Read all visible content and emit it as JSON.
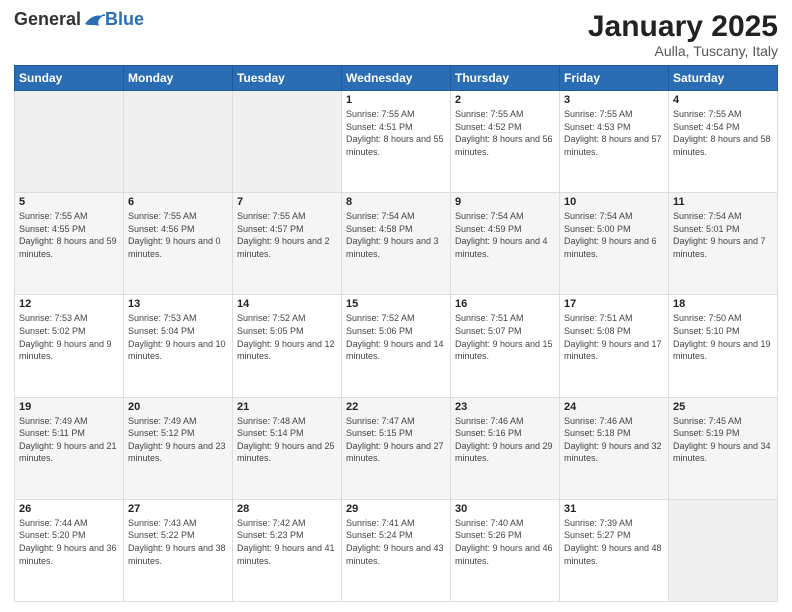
{
  "header": {
    "logo_general": "General",
    "logo_blue": "Blue",
    "month": "January 2025",
    "location": "Aulla, Tuscany, Italy"
  },
  "days_of_week": [
    "Sunday",
    "Monday",
    "Tuesday",
    "Wednesday",
    "Thursday",
    "Friday",
    "Saturday"
  ],
  "weeks": [
    [
      {
        "day": "",
        "sunrise": "",
        "sunset": "",
        "daylight": ""
      },
      {
        "day": "",
        "sunrise": "",
        "sunset": "",
        "daylight": ""
      },
      {
        "day": "",
        "sunrise": "",
        "sunset": "",
        "daylight": ""
      },
      {
        "day": "1",
        "sunrise": "Sunrise: 7:55 AM",
        "sunset": "Sunset: 4:51 PM",
        "daylight": "Daylight: 8 hours and 55 minutes."
      },
      {
        "day": "2",
        "sunrise": "Sunrise: 7:55 AM",
        "sunset": "Sunset: 4:52 PM",
        "daylight": "Daylight: 8 hours and 56 minutes."
      },
      {
        "day": "3",
        "sunrise": "Sunrise: 7:55 AM",
        "sunset": "Sunset: 4:53 PM",
        "daylight": "Daylight: 8 hours and 57 minutes."
      },
      {
        "day": "4",
        "sunrise": "Sunrise: 7:55 AM",
        "sunset": "Sunset: 4:54 PM",
        "daylight": "Daylight: 8 hours and 58 minutes."
      }
    ],
    [
      {
        "day": "5",
        "sunrise": "Sunrise: 7:55 AM",
        "sunset": "Sunset: 4:55 PM",
        "daylight": "Daylight: 8 hours and 59 minutes."
      },
      {
        "day": "6",
        "sunrise": "Sunrise: 7:55 AM",
        "sunset": "Sunset: 4:56 PM",
        "daylight": "Daylight: 9 hours and 0 minutes."
      },
      {
        "day": "7",
        "sunrise": "Sunrise: 7:55 AM",
        "sunset": "Sunset: 4:57 PM",
        "daylight": "Daylight: 9 hours and 2 minutes."
      },
      {
        "day": "8",
        "sunrise": "Sunrise: 7:54 AM",
        "sunset": "Sunset: 4:58 PM",
        "daylight": "Daylight: 9 hours and 3 minutes."
      },
      {
        "day": "9",
        "sunrise": "Sunrise: 7:54 AM",
        "sunset": "Sunset: 4:59 PM",
        "daylight": "Daylight: 9 hours and 4 minutes."
      },
      {
        "day": "10",
        "sunrise": "Sunrise: 7:54 AM",
        "sunset": "Sunset: 5:00 PM",
        "daylight": "Daylight: 9 hours and 6 minutes."
      },
      {
        "day": "11",
        "sunrise": "Sunrise: 7:54 AM",
        "sunset": "Sunset: 5:01 PM",
        "daylight": "Daylight: 9 hours and 7 minutes."
      }
    ],
    [
      {
        "day": "12",
        "sunrise": "Sunrise: 7:53 AM",
        "sunset": "Sunset: 5:02 PM",
        "daylight": "Daylight: 9 hours and 9 minutes."
      },
      {
        "day": "13",
        "sunrise": "Sunrise: 7:53 AM",
        "sunset": "Sunset: 5:04 PM",
        "daylight": "Daylight: 9 hours and 10 minutes."
      },
      {
        "day": "14",
        "sunrise": "Sunrise: 7:52 AM",
        "sunset": "Sunset: 5:05 PM",
        "daylight": "Daylight: 9 hours and 12 minutes."
      },
      {
        "day": "15",
        "sunrise": "Sunrise: 7:52 AM",
        "sunset": "Sunset: 5:06 PM",
        "daylight": "Daylight: 9 hours and 14 minutes."
      },
      {
        "day": "16",
        "sunrise": "Sunrise: 7:51 AM",
        "sunset": "Sunset: 5:07 PM",
        "daylight": "Daylight: 9 hours and 15 minutes."
      },
      {
        "day": "17",
        "sunrise": "Sunrise: 7:51 AM",
        "sunset": "Sunset: 5:08 PM",
        "daylight": "Daylight: 9 hours and 17 minutes."
      },
      {
        "day": "18",
        "sunrise": "Sunrise: 7:50 AM",
        "sunset": "Sunset: 5:10 PM",
        "daylight": "Daylight: 9 hours and 19 minutes."
      }
    ],
    [
      {
        "day": "19",
        "sunrise": "Sunrise: 7:49 AM",
        "sunset": "Sunset: 5:11 PM",
        "daylight": "Daylight: 9 hours and 21 minutes."
      },
      {
        "day": "20",
        "sunrise": "Sunrise: 7:49 AM",
        "sunset": "Sunset: 5:12 PM",
        "daylight": "Daylight: 9 hours and 23 minutes."
      },
      {
        "day": "21",
        "sunrise": "Sunrise: 7:48 AM",
        "sunset": "Sunset: 5:14 PM",
        "daylight": "Daylight: 9 hours and 25 minutes."
      },
      {
        "day": "22",
        "sunrise": "Sunrise: 7:47 AM",
        "sunset": "Sunset: 5:15 PM",
        "daylight": "Daylight: 9 hours and 27 minutes."
      },
      {
        "day": "23",
        "sunrise": "Sunrise: 7:46 AM",
        "sunset": "Sunset: 5:16 PM",
        "daylight": "Daylight: 9 hours and 29 minutes."
      },
      {
        "day": "24",
        "sunrise": "Sunrise: 7:46 AM",
        "sunset": "Sunset: 5:18 PM",
        "daylight": "Daylight: 9 hours and 32 minutes."
      },
      {
        "day": "25",
        "sunrise": "Sunrise: 7:45 AM",
        "sunset": "Sunset: 5:19 PM",
        "daylight": "Daylight: 9 hours and 34 minutes."
      }
    ],
    [
      {
        "day": "26",
        "sunrise": "Sunrise: 7:44 AM",
        "sunset": "Sunset: 5:20 PM",
        "daylight": "Daylight: 9 hours and 36 minutes."
      },
      {
        "day": "27",
        "sunrise": "Sunrise: 7:43 AM",
        "sunset": "Sunset: 5:22 PM",
        "daylight": "Daylight: 9 hours and 38 minutes."
      },
      {
        "day": "28",
        "sunrise": "Sunrise: 7:42 AM",
        "sunset": "Sunset: 5:23 PM",
        "daylight": "Daylight: 9 hours and 41 minutes."
      },
      {
        "day": "29",
        "sunrise": "Sunrise: 7:41 AM",
        "sunset": "Sunset: 5:24 PM",
        "daylight": "Daylight: 9 hours and 43 minutes."
      },
      {
        "day": "30",
        "sunrise": "Sunrise: 7:40 AM",
        "sunset": "Sunset: 5:26 PM",
        "daylight": "Daylight: 9 hours and 46 minutes."
      },
      {
        "day": "31",
        "sunrise": "Sunrise: 7:39 AM",
        "sunset": "Sunset: 5:27 PM",
        "daylight": "Daylight: 9 hours and 48 minutes."
      },
      {
        "day": "",
        "sunrise": "",
        "sunset": "",
        "daylight": ""
      }
    ]
  ]
}
